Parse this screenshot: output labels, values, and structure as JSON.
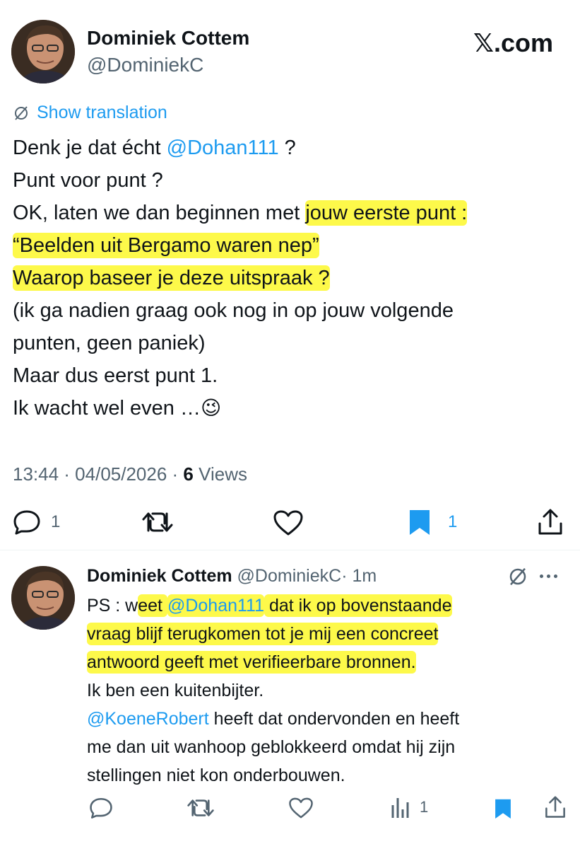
{
  "header": {
    "author_name": "Dominiek Cottem",
    "author_handle": "@DominiekC",
    "brand": "𝕏.com"
  },
  "tweet": {
    "translate_label": "Show translation",
    "lines": [
      {
        "parts": [
          "Denk je dat écht ",
          "@Dohan111",
          " ?"
        ]
      },
      {
        "text": "Punt voor punt ?"
      },
      {
        "pre": "OK, laten we dan beginnen met ",
        "hl": "jouw eerste punt :"
      },
      {
        "text": "“Beelden uit Bergamo waren nep”"
      },
      {
        "text": "Waarop baseer je deze uitspraak ?"
      },
      {
        "text": "(ik ga nadien graag ook nog in op jouw volgende"
      },
      {
        "text": "punten, geen paniek)"
      },
      {
        "text": "Maar dus eerst punt 1."
      },
      {
        "text": "Ik wacht wel even …"
      }
    ],
    "emoji": "😉",
    "timestamp": "13:44 · 04/05/2026 · ",
    "views_count": "6",
    "views_label": " Views",
    "actions": {
      "reply_count": "1",
      "retweet_count": "",
      "like_count": "",
      "bookmark_count": "1"
    }
  },
  "reply": {
    "author_name": "Dominiek Cottem",
    "author_handle": "@DominiekC",
    "time": "· 1m",
    "lines": [
      {
        "pre": "PS : w",
        "hl_a": "eet ",
        "hl_link": "@Dohan111",
        "hl_b": " dat ik op bovenstaande"
      },
      {
        "hl": "vraag blijf terugkomen tot je mij een concreet"
      },
      {
        "hl": "antwoord geeft met verifieerbare bronnen."
      },
      {
        "text": "Ik ben een kuitenbijter."
      },
      {
        "link": "@KoeneRobert",
        "rest": " heeft dat ondervonden en heeft"
      },
      {
        "text": "me dan uit wanhoop geblokkeerd omdat hij zijn"
      },
      {
        "text": "stellingen niet kon onderbouwen."
      }
    ],
    "actions": {
      "views_count": "1"
    }
  },
  "colors": {
    "highlight": "#fdf94a",
    "link": "#1d9bf0",
    "bookmark_active": "#1d9bf0",
    "muted": "#536471"
  }
}
